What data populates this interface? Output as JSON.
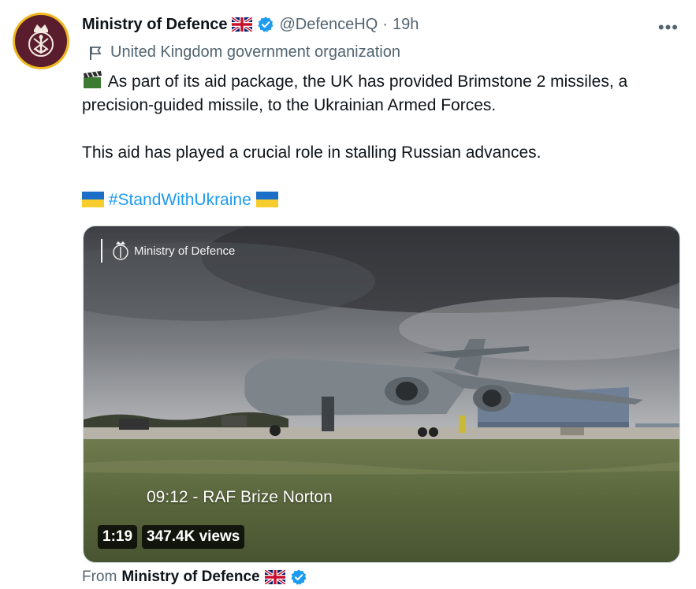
{
  "author": {
    "name": "Ministry of Defence",
    "handle": "@DefenceHQ",
    "separator": "·",
    "time": "19h",
    "label": "United Kingdom government organization"
  },
  "icons": {
    "flag": "uk-flag-icon",
    "verified": "verified-badge-icon",
    "more": "more-options-icon",
    "label": "government-flag-icon",
    "clapper": "clapper-board-icon",
    "ukraine": "ukraine-flag-icon"
  },
  "more_label": "•••",
  "tweet": {
    "line1": "As part of its aid package, the UK has provided Brimstone 2 missiles, a precision-guided missile, to the Ukrainian Armed Forces.",
    "line2": "This aid has played a crucial role in stalling Russian advances.",
    "hashtag": "#StandWithUkraine"
  },
  "video": {
    "watermark": "Ministry of Defence",
    "caption": "09:12 - RAF Brize Norton",
    "duration": "1:19",
    "views": "347.4K views"
  },
  "footer": {
    "prefix": "From",
    "source": "Ministry of Defence"
  },
  "colors": {
    "accent": "#1d9bf0",
    "avatar_ring": "#f0b81e",
    "avatar_bg": "#5a1d2e",
    "secondary_text": "#536471"
  }
}
